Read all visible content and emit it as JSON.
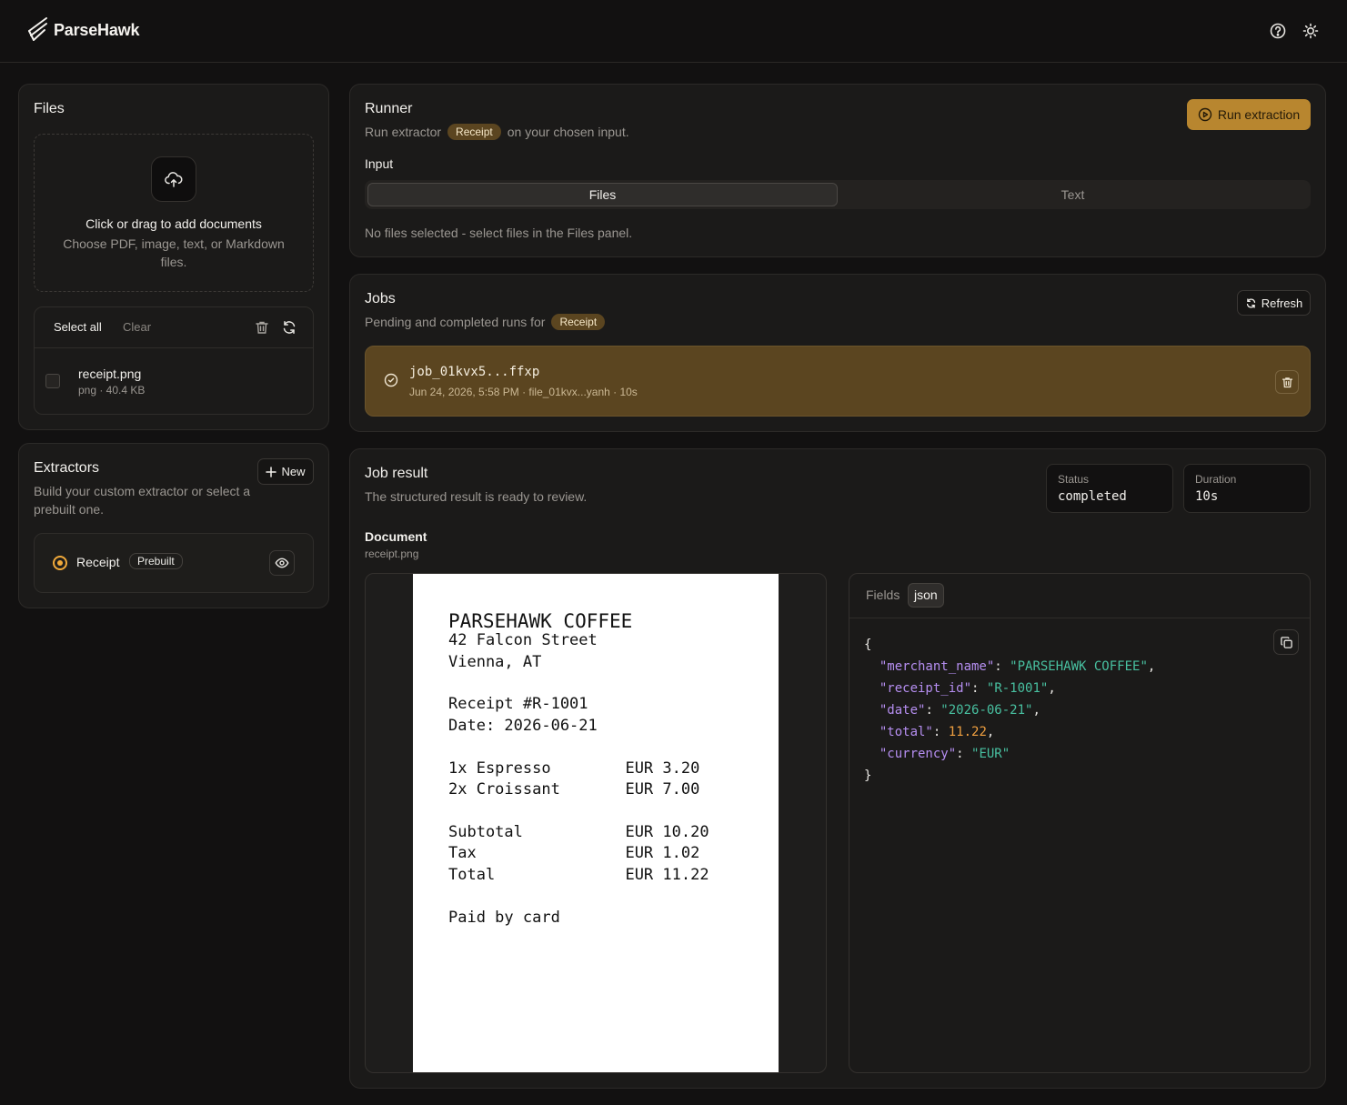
{
  "app": {
    "name": "ParseHawk"
  },
  "header": {
    "help_icon": "help-circle-icon",
    "theme_icon": "sun-icon"
  },
  "files": {
    "title": "Files",
    "dropzone": {
      "title": "Click or drag to add documents",
      "subtitle": "Choose PDF, image, text, or Markdown files."
    },
    "toolbar": {
      "select_all": "Select all",
      "clear": "Clear"
    },
    "items": [
      {
        "name": "receipt.png",
        "meta": "png · 40.4 KB"
      }
    ]
  },
  "extractors": {
    "title": "Extractors",
    "subtitle": "Build your custom extractor or select a prebuilt one.",
    "new_label": "New",
    "items": [
      {
        "name": "Receipt",
        "tag": "Prebuilt"
      }
    ]
  },
  "runner": {
    "title": "Runner",
    "desc_before": "Run extractor",
    "extractor": "Receipt",
    "desc_after": "on your chosen input.",
    "run_label": "Run extraction",
    "input_label": "Input",
    "tabs": [
      "Files",
      "Text"
    ],
    "empty": "No files selected - select files in the Files panel."
  },
  "jobs": {
    "title": "Jobs",
    "desc": "Pending and completed runs for",
    "extractor": "Receipt",
    "refresh_label": "Refresh",
    "items": [
      {
        "id": "job_01kvx5...ffxp",
        "meta": "Jun 24, 2026, 5:58 PM · file_01kvx...yanh · 10s"
      }
    ]
  },
  "result": {
    "title": "Job result",
    "desc": "The structured result is ready to review.",
    "status_label": "Status",
    "status_value": "completed",
    "duration_label": "Duration",
    "duration_value": "10s",
    "document_label": "Document",
    "document_name": "receipt.png",
    "tabs": [
      "Fields",
      "json"
    ],
    "json": {
      "merchant_name": "PARSEHAWK COFFEE",
      "receipt_id": "R-1001",
      "date": "2026-06-21",
      "total": "11.22",
      "currency": "EUR"
    }
  },
  "receipt_image": {
    "lines": [
      "PARSEHAWK COFFEE",
      "42 Falcon Street",
      "Vienna, AT",
      "Receipt #R-1001",
      "Date: 2026-06-21",
      "1x Espresso        EUR 3.20",
      "2x Croissant       EUR 7.00",
      "Subtotal           EUR 10.20",
      "Tax                EUR 1.02",
      "Total              EUR 11.22",
      "Paid by card"
    ]
  },
  "colors": {
    "accent": "#b8862f",
    "pill": "#5b4520",
    "background": "#121111",
    "card": "#1b1a19"
  }
}
